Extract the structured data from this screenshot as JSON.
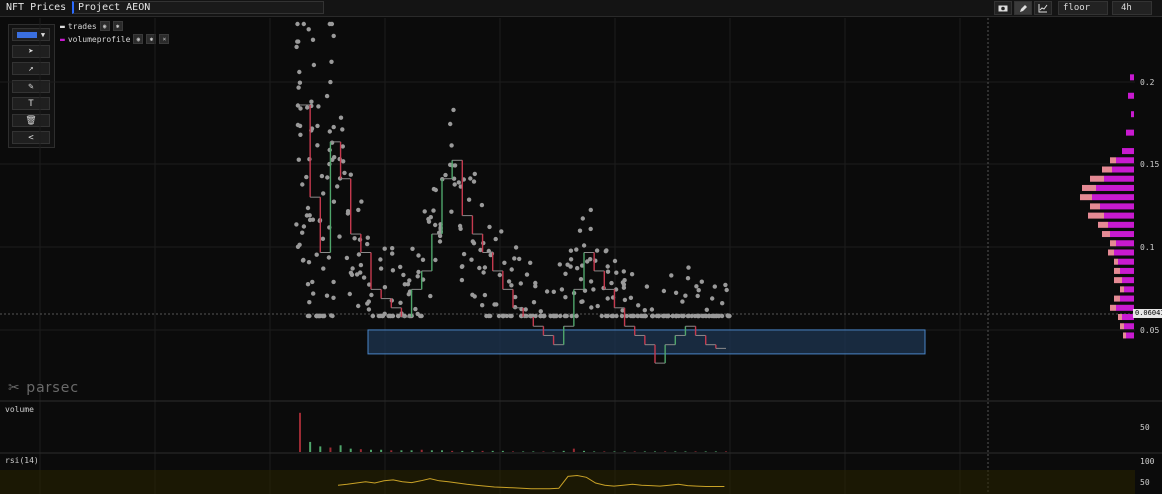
{
  "app": {
    "tab_label": "NFT Prices",
    "search_value": "Project AEON"
  },
  "toolbar": {
    "camera_icon": "camera-icon",
    "pencil_icon": "pencil-icon",
    "chart_icon": "chart-icon",
    "metric_label": "floor",
    "interval_label": "4h"
  },
  "drawing_tools": {
    "tools": [
      "color",
      "cursor",
      "arrow",
      "pencil",
      "text",
      "trash",
      "collapse"
    ],
    "text_label": "T",
    "collapse_label": "<"
  },
  "legend": {
    "trades_label": "trades",
    "volumeprofile_label": "volumeprofile"
  },
  "price_axis": {
    "ticks": [
      "0.2",
      "0.15",
      "0.1",
      "0.05"
    ],
    "current_price": "0.06041"
  },
  "panes": {
    "volume_label": "volume",
    "volume_tick": "50",
    "rsi_label": "rsi(14)",
    "rsi_tick_top": "100",
    "rsi_tick_mid": "50"
  },
  "branding": {
    "watermark": "parsec"
  },
  "chart_data": {
    "type": "scatter",
    "price_ylim": [
      0.04,
      0.245
    ],
    "current_price": 0.06041,
    "support_zone": [
      0.065,
      0.078
    ],
    "close_series": [
      0.2,
      0.15,
      0.12,
      0.18,
      0.16,
      0.13,
      0.12,
      0.1,
      0.095,
      0.09,
      0.085,
      0.1,
      0.11,
      0.13,
      0.16,
      0.17,
      0.14,
      0.13,
      0.12,
      0.11,
      0.1,
      0.09,
      0.085,
      0.08,
      0.075,
      0.07,
      0.08,
      0.1,
      0.12,
      0.11,
      0.1,
      0.09,
      0.08,
      0.075,
      0.07,
      0.06,
      0.07,
      0.075,
      0.08,
      0.075,
      0.07,
      0.068,
      0.068
    ],
    "volume": [
      70,
      18,
      10,
      8,
      12,
      6,
      5,
      4,
      4,
      3,
      3,
      3,
      4,
      3,
      3,
      2,
      2,
      2,
      2,
      2,
      2,
      1,
      1,
      1,
      1,
      1,
      2,
      6,
      2,
      1,
      1,
      1,
      1,
      1,
      1,
      1,
      1,
      1,
      1,
      1,
      1,
      1,
      1
    ],
    "rsi": [
      50,
      52,
      55,
      58,
      55,
      60,
      62,
      58,
      56,
      60,
      65,
      60,
      58,
      55,
      52,
      50,
      48,
      46,
      45,
      44,
      43,
      42,
      42,
      42,
      43,
      70,
      72,
      68,
      55,
      50,
      48,
      50,
      52,
      50,
      49,
      48,
      50,
      52,
      49,
      48,
      47,
      47,
      47
    ],
    "volume_profile": [
      {
        "price": 0.215,
        "a": 4,
        "b": 0
      },
      {
        "price": 0.205,
        "a": 6,
        "b": 0
      },
      {
        "price": 0.195,
        "a": 3,
        "b": 0
      },
      {
        "price": 0.185,
        "a": 8,
        "b": 0
      },
      {
        "price": 0.175,
        "a": 12,
        "b": 0
      },
      {
        "price": 0.17,
        "a": 18,
        "b": 6
      },
      {
        "price": 0.165,
        "a": 22,
        "b": 10
      },
      {
        "price": 0.16,
        "a": 30,
        "b": 14
      },
      {
        "price": 0.155,
        "a": 38,
        "b": 14
      },
      {
        "price": 0.15,
        "a": 42,
        "b": 12
      },
      {
        "price": 0.145,
        "a": 34,
        "b": 10
      },
      {
        "price": 0.14,
        "a": 30,
        "b": 16
      },
      {
        "price": 0.135,
        "a": 26,
        "b": 10
      },
      {
        "price": 0.13,
        "a": 24,
        "b": 8
      },
      {
        "price": 0.125,
        "a": 18,
        "b": 6
      },
      {
        "price": 0.12,
        "a": 20,
        "b": 6
      },
      {
        "price": 0.115,
        "a": 16,
        "b": 4
      },
      {
        "price": 0.11,
        "a": 14,
        "b": 6
      },
      {
        "price": 0.105,
        "a": 12,
        "b": 8
      },
      {
        "price": 0.1,
        "a": 10,
        "b": 4
      },
      {
        "price": 0.095,
        "a": 14,
        "b": 6
      },
      {
        "price": 0.09,
        "a": 18,
        "b": 6
      },
      {
        "price": 0.085,
        "a": 12,
        "b": 4
      },
      {
        "price": 0.08,
        "a": 10,
        "b": 4
      },
      {
        "price": 0.075,
        "a": 8,
        "b": 3
      }
    ]
  },
  "colors": {
    "bg": "#0b0b0b",
    "trade_dot": "#9a9a9a",
    "up": "#4fa66b",
    "down": "#c73a4f",
    "profile_main": "#c81ad0",
    "profile_alt": "#e58a94",
    "rsi_line": "#c9a227",
    "zone_fill": "#1e3552",
    "zone_border": "#4a86c8",
    "volume_bar": "#9c2b34"
  }
}
